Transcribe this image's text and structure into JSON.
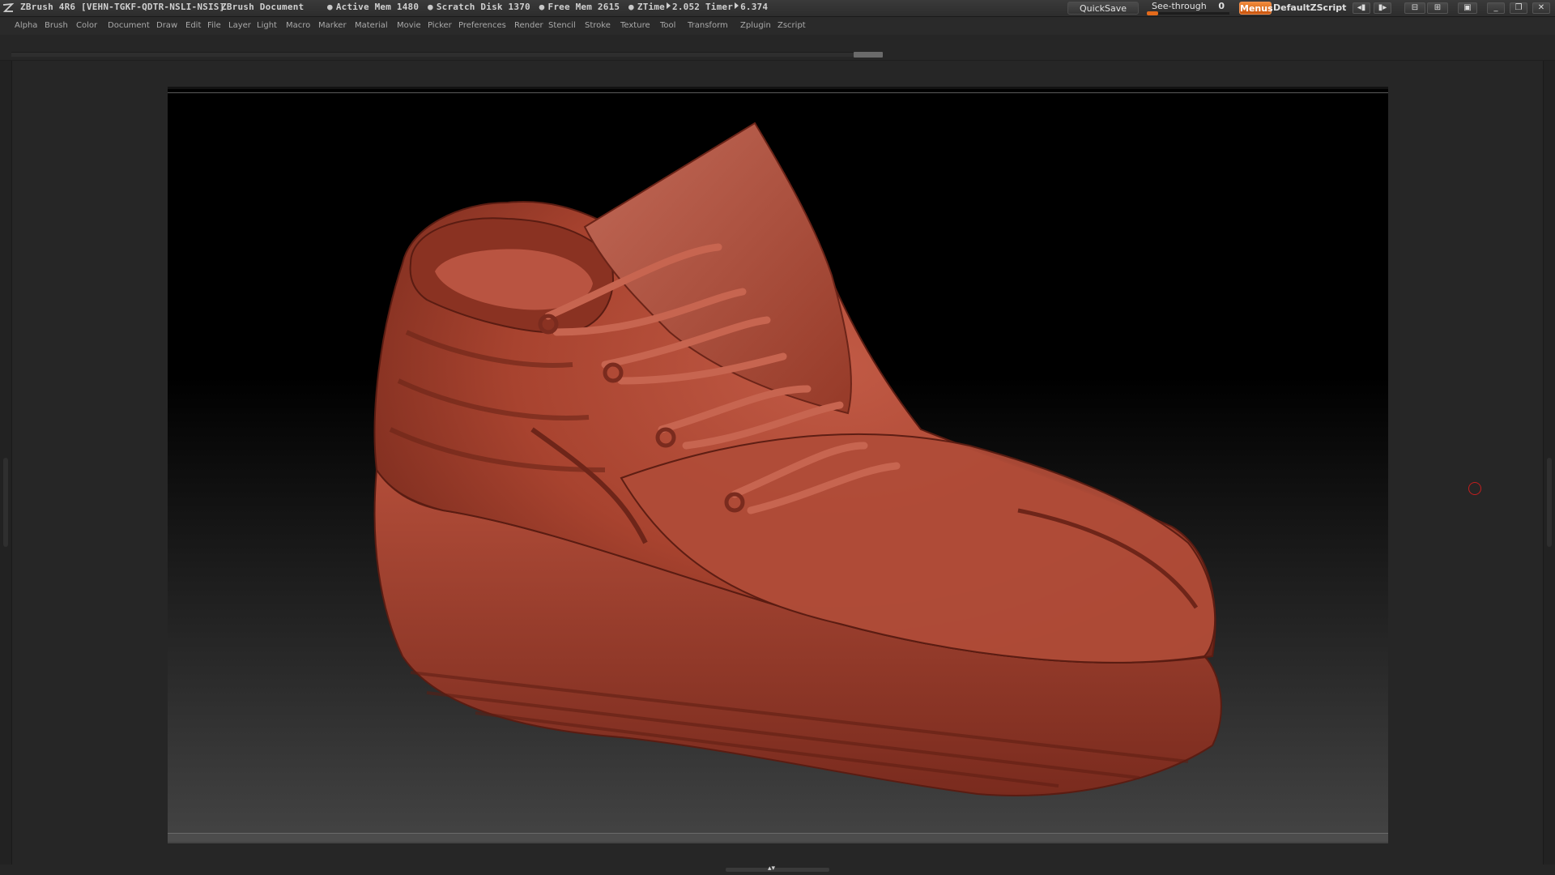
{
  "titlebar": {
    "app_title": "ZBrush 4R6 [VEHN-TGKF-QDTR-NSLI-NSIS]",
    "document_title": "ZBrush Document",
    "active_mem_label": "Active Mem",
    "active_mem_value": "1480",
    "scratch_disk_label": "Scratch Disk",
    "scratch_disk_value": "1370",
    "free_mem_label": "Free Mem",
    "free_mem_value": "2615",
    "ztime_label": "ZTime",
    "ztime_value": "2.052",
    "timer_label": "Timer",
    "timer_value": "6.374",
    "quicksave_label": "QuickSave",
    "seethrough_label": "See-through",
    "seethrough_value": "0",
    "seethrough_level": 0,
    "menus_label": "Menus",
    "script_label": "DefaultZScript",
    "accent_color": "#e8701f"
  },
  "menubar": {
    "items": [
      "Alpha",
      "Brush",
      "Color",
      "Document",
      "Draw",
      "Edit",
      "File",
      "Layer",
      "Light",
      "Macro",
      "Marker",
      "Material",
      "Movie",
      "Picker",
      "Preferences",
      "Render",
      "Stencil",
      "Stroke",
      "Texture",
      "Tool",
      "Transform",
      "Zplugin",
      "Zscript"
    ]
  },
  "canvas": {
    "model_material_color": "#a8432f",
    "background_top": "#000000",
    "background_bottom": "#444444",
    "brush_cursor_color": "#c21e1e"
  },
  "icons": {
    "zbrush_logo": "zbrush-logo-icon",
    "minimize": "minimize-icon",
    "restore": "restore-icon",
    "close": "close-icon"
  }
}
